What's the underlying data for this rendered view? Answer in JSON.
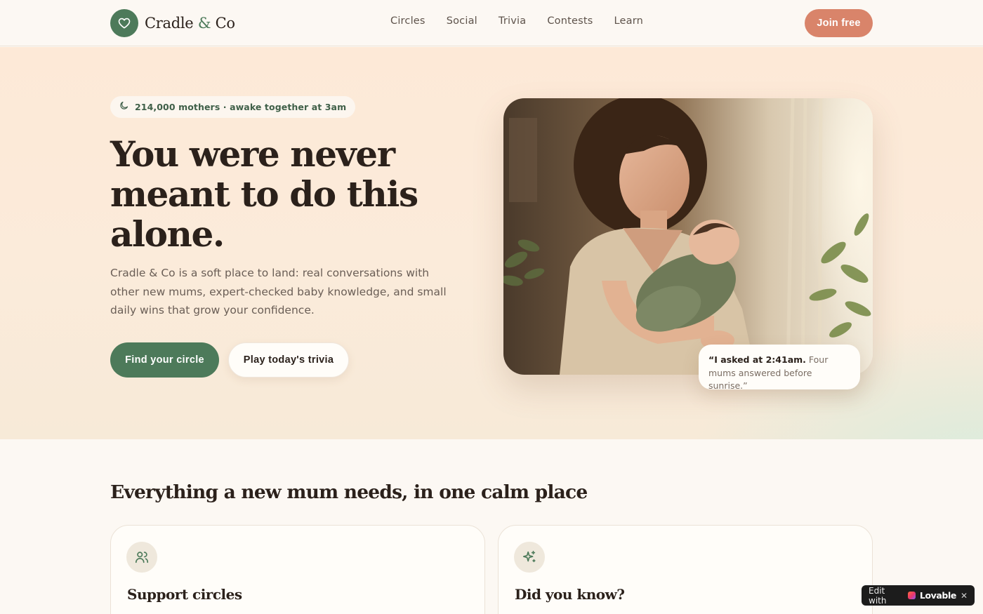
{
  "nav": {
    "brand_prefix": "Cradle",
    "brand_amp": "&",
    "brand_suffix": "Co",
    "links": [
      "Circles",
      "Social",
      "Trivia",
      "Contests",
      "Learn"
    ],
    "cta": "Join free"
  },
  "hero": {
    "pill_text": "214,000 mothers · awake together at 3am",
    "headline": "You were never meant to do this alone.",
    "lead": "Cradle & Co is a soft place to land: real conversations with other new mums, expert-checked baby knowledge, and small daily wins that grow your confidence.",
    "primary_cta": "Find your circle",
    "secondary_cta": "Play today's trivia",
    "quote_strong": "“I asked at 2:41am.",
    "quote_rest": " Four mums answered before sunrise.”"
  },
  "features": {
    "title": "Everything a new mum needs, in one calm place",
    "cards": [
      {
        "title": "Support circles",
        "icon": "users-icon"
      },
      {
        "title": "Did you know?",
        "icon": "sparkles-icon"
      }
    ]
  },
  "badge": {
    "prefix": "Edit with",
    "brand": "Lovable",
    "close": "✕"
  },
  "colors": {
    "accent_green": "#4d7a5a",
    "accent_coral": "#d9846a",
    "background": "#fcf8f3",
    "text_dark": "#2b211b"
  }
}
